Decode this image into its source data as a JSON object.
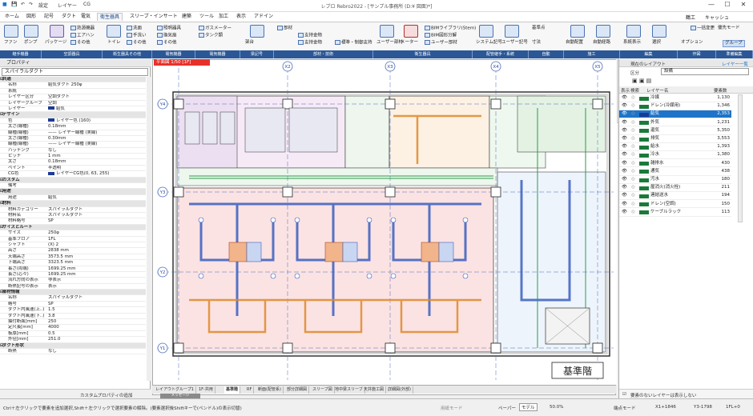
{
  "titlebar": {
    "title": "レブロ Rebro2022 - [サンプル事務所 (D:¥ 図面)*]",
    "qa": [
      "設定",
      "レイヤー",
      "CG"
    ],
    "minimize": "—",
    "maximize": "☐",
    "close": "✕"
  },
  "menubar": {
    "items": [
      "ホーム",
      "図形",
      "記号",
      "ダクト",
      "電気",
      "衛生器具",
      "スリーブ・インサート",
      "建築",
      "ツール",
      "加工",
      "表示",
      "アドイン"
    ],
    "active_index": 5,
    "right": [
      "鶴工",
      "キャッシュ"
    ]
  },
  "ribbon": {
    "groups": [
      "継手機器",
      "空調器具",
      "衛生器具その他",
      "電気機器",
      "電気機器",
      "梁記号",
      "部材・技術",
      "衛生器具",
      "配管継手・系統",
      "自動",
      "施工",
      "編集",
      "作図",
      "電気設置",
      "準備編集"
    ],
    "buttons": {
      "fan": "ファン",
      "pump": "ポンプ",
      "package": "パッケージ",
      "cooling_tower": "熱源機器",
      "air_handler": "エアハン",
      "other": "その他",
      "toilet": "トイレ",
      "washbasin": "洗面",
      "hand_wash": "手洗い",
      "other2": "その他",
      "lighting": "照明器具",
      "air_conditioner": "エアコンクーラー",
      "exhaust_fan": "換気扇",
      "other3": "その他",
      "gas_meter": "ガスメーター",
      "tank": "タンク類",
      "sprinkler": "スプリンクラー",
      "sleeve": "スリーブ",
      "beam_symbol": "梁記号",
      "frame": "架台",
      "parts": "部材",
      "support": "支持金物",
      "support2": "支持金物",
      "standard": "標準・制御支持",
      "user_parts": "ユーザー部材",
      "meter": "メーター",
      "cad_dwg": "CAD図形・取込",
      "bim_library": "BIMライブラリ(Stem)",
      "smart_bim": "BIM図形分解",
      "user_library": "ユーザー部材",
      "system_symbols": "システム記号",
      "user_symbols": "ユーザー記号",
      "auto_layout": "自動配置",
      "auto_route": "自動経路",
      "ref_point": "基準点",
      "dimension": "寸法",
      "connection_view": "系統表示",
      "select": "選択",
      "unify": "一括変更",
      "option": "オプション",
      "group": "グループ",
      "layer_select": "優先モード"
    }
  },
  "left_panel": {
    "header": "プロパティ",
    "combo": "スパイラルダクト",
    "rows": [
      {
        "t": "s",
        "k": "共通"
      },
      {
        "k": "名称",
        "v": "給気ダクト 250φ"
      },
      {
        "k": "系統"
      },
      {
        "k": "レイヤー区分",
        "v": "空調ダクト"
      },
      {
        "k": "レイヤーグループ",
        "v": "空調"
      },
      {
        "k": "レイヤー",
        "v": "給気",
        "sw": "#1f3a93"
      },
      {
        "t": "s",
        "k": "デザイン"
      },
      {
        "k": "色",
        "v": "レイヤー色 (160)",
        "sw": "#1f3a93"
      },
      {
        "k": "太さ(線種)",
        "v": "0.18mm"
      },
      {
        "k": "線種(線種)",
        "v": "—— レイヤー線種 (実線)"
      },
      {
        "k": "太さ(線種)",
        "v": "0.30mm"
      },
      {
        "k": "線種(線種)",
        "v": "—— レイヤー線種 (実線)"
      },
      {
        "k": "ハッチング",
        "v": "なし"
      },
      {
        "k": "ピッチ",
        "v": "1 mm"
      },
      {
        "k": "太さ",
        "v": "0.18mm"
      },
      {
        "k": "ペイント",
        "v": "半透明"
      },
      {
        "k": "CG色",
        "v": "レイヤーCG色(0, 63, 255)",
        "sw": "#1f3a93"
      },
      {
        "t": "s",
        "k": "カスタム"
      },
      {
        "k": "備考"
      },
      {
        "t": "s",
        "k": "用途"
      },
      {
        "k": "用途",
        "v": "給気"
      },
      {
        "t": "s",
        "k": "材料"
      },
      {
        "k": "材料カテゴリー",
        "v": "スパイラルダクト"
      },
      {
        "k": "材料名",
        "v": "スパイラルダクト"
      },
      {
        "k": "材料略号",
        "v": "SP"
      },
      {
        "t": "s",
        "k": "サイズとルート"
      },
      {
        "k": "サイズ",
        "v": "250φ"
      },
      {
        "k": "基準フロア",
        "v": "1FL"
      },
      {
        "k": "シャフト",
        "v": "(X) 2"
      },
      {
        "k": "高さ",
        "v": "2838 mm"
      },
      {
        "k": "天端高さ",
        "v": "3573.5 mm"
      },
      {
        "k": "下端高さ",
        "v": "3323.5 mm"
      },
      {
        "k": "長さ(両端)",
        "v": "1699.25 mm"
      },
      {
        "k": "長さ(芯々)",
        "v": "1699.25 mm"
      },
      {
        "k": "流れ方向の表示",
        "v": "非表示"
      },
      {
        "k": "断熱記号の表示",
        "v": "表示"
      },
      {
        "t": "s",
        "k": "部材情報"
      },
      {
        "k": "名称",
        "v": "スパイラルダクト"
      },
      {
        "k": "略号",
        "v": "SP"
      },
      {
        "k": "ダクト内風速(上..)",
        "v": "1.5"
      },
      {
        "k": "ダクト内風速(下..)",
        "v": "3.8"
      },
      {
        "k": "抽付断面[mm]",
        "v": "250"
      },
      {
        "k": "定尺長[mm]",
        "v": "4000"
      },
      {
        "k": "板厚[mm]",
        "v": "0.5"
      },
      {
        "k": "外径[mm]",
        "v": "251.0"
      },
      {
        "t": "s",
        "k": "ダクト形状"
      },
      {
        "k": "断熱",
        "v": "なし"
      }
    ],
    "footer": "カスタムプロパティの追加"
  },
  "canvas": {
    "view_tab": "平面図 1/50 [1F]",
    "grid_x": [
      "X1",
      "X2",
      "X3",
      "X4",
      "X5"
    ],
    "grid_y": [
      "Y4",
      "Y3",
      "Y2",
      "Y1"
    ],
    "stamp": "基準階",
    "bottom_tabs": [
      "レイアウトグループ1",
      "1F-共用",
      "基準階",
      "RF",
      "断面(配管系)",
      "部分詳細図",
      "スリーブ図",
      "地中梁スリーブ",
      "天井施工図",
      "詳細図(外部)"
    ],
    "active_tab_index": 2,
    "message": "メッセージ"
  },
  "right_panel": {
    "header": "レイヤー一覧",
    "current_layout": "現在のレイアウト",
    "category_label": "区分",
    "category_value": "設備",
    "columns": [
      "表示",
      "検索",
      "レイヤー名",
      "要素数"
    ],
    "layers": [
      {
        "name": "冷媒",
        "count": "1,130",
        "color": "#1a7a3a"
      },
      {
        "name": "ドレン(冷媒用)",
        "count": "1,346",
        "color": "#1a7a3a"
      },
      {
        "name": "給気",
        "count": "2,353",
        "color": "#1f3a93",
        "selected": true
      },
      {
        "name": "外気",
        "count": "1,231",
        "color": "#1a7a3a"
      },
      {
        "name": "還気",
        "count": "5,350",
        "color": "#1a7a3a"
      },
      {
        "name": "排気",
        "count": "3,553",
        "color": "#1a7a3a"
      },
      {
        "name": "給水",
        "count": "1,393",
        "color": "#1a7a3a"
      },
      {
        "name": "冷水",
        "count": "1,380",
        "color": "#1a7a3a"
      },
      {
        "name": "雑排水",
        "count": "430",
        "color": "#1a7a3a"
      },
      {
        "name": "通気",
        "count": "438",
        "color": "#1a7a3a"
      },
      {
        "name": "汚水",
        "count": "180",
        "color": "#1a7a3a"
      },
      {
        "name": "屋消火(消火栓)",
        "count": "211",
        "color": "#1a7a3a"
      },
      {
        "name": "連結送水",
        "count": "194",
        "color": "#1a7a3a"
      },
      {
        "name": "ドレン(空調)",
        "count": "150",
        "color": "#1a7a3a"
      },
      {
        "name": "ケーブルラック",
        "count": "113",
        "color": "#1a7a3a"
      }
    ],
    "footer_checkbox": "要素のないレイヤーは表示しない"
  },
  "status": {
    "hint": "Ctrl＋左クリックで要素を追加選択,Shift＋左クリックで選択要素の解除。(要素選択後Shiftキーで(ペンドル)の表示切替)",
    "mode1": "用紙モード",
    "paper": "ペーパー",
    "model": "モデル",
    "zoom": "50.0%",
    "snap": "端点モード",
    "coord_x": "X1+1846",
    "coord_y": "Y3-1798",
    "floor": "1FL+0"
  }
}
